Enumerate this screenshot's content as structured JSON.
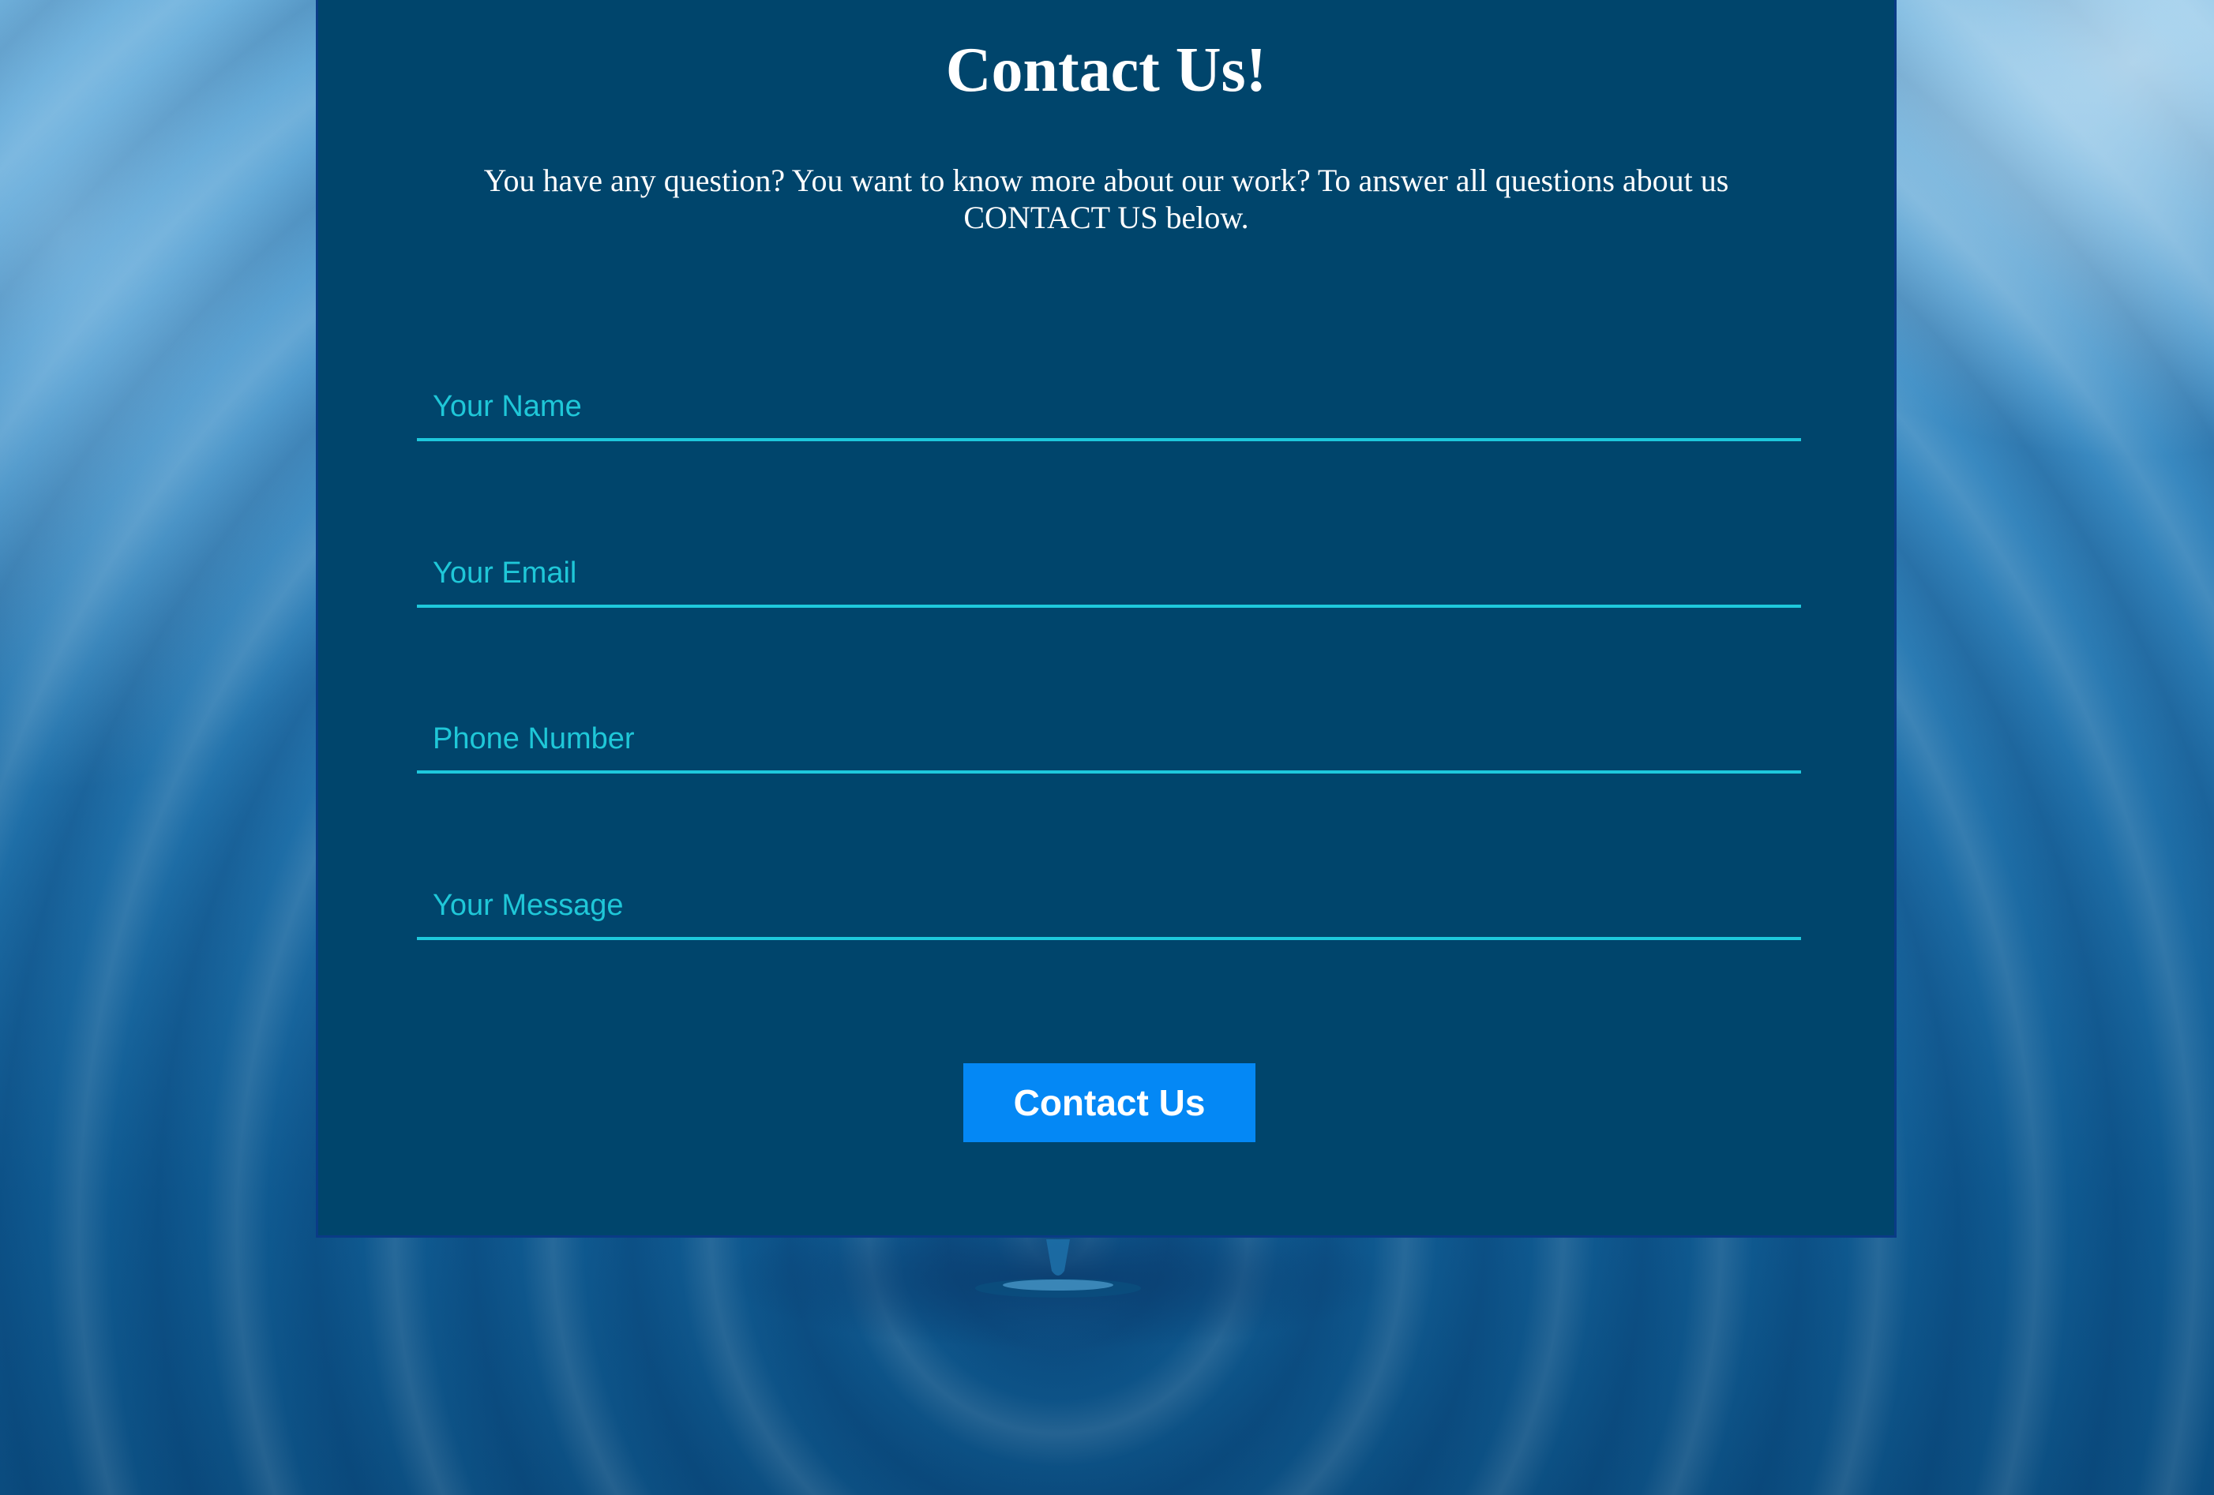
{
  "contact": {
    "title": "Contact Us!",
    "intro": "You have any question? You want to know more about our work? To answer all questions about us CONTACT US below.",
    "fields": {
      "name_placeholder": "Your Name",
      "email_placeholder": "Your Email",
      "phone_placeholder": "Phone Number",
      "message_placeholder": "Your Message"
    },
    "submit_label": "Contact Us"
  },
  "colors": {
    "panel_bg": "#00456c",
    "panel_border": "#0a3b86",
    "field_accent": "#1ec8dc",
    "button_bg": "#0488f5",
    "text_primary": "#ffffff"
  },
  "background": {
    "icon": "water-ripple-image"
  }
}
